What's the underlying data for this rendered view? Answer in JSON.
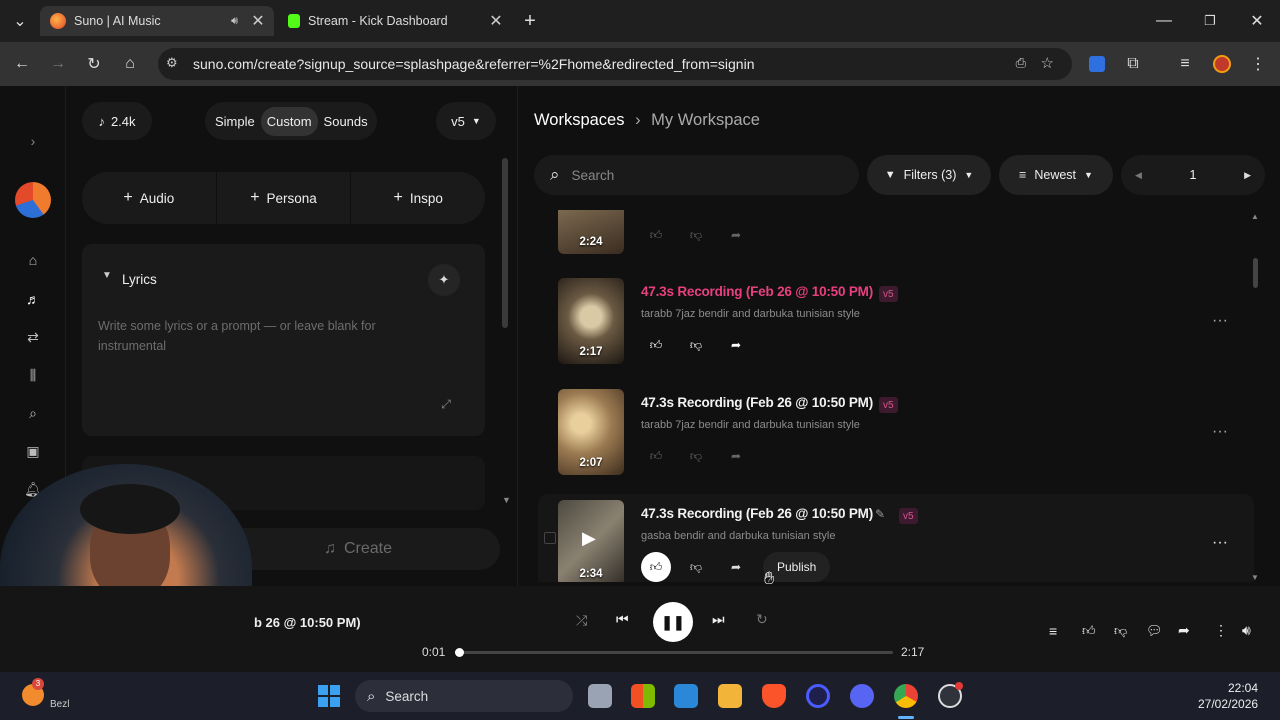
{
  "browser": {
    "tabs": [
      {
        "title": "Suno | AI Music",
        "active": true,
        "audio": true
      },
      {
        "title": "Stream - Kick Dashboard",
        "active": false
      }
    ],
    "url": "suno.com/create?signup_source=splashpage&referrer=%2Fhome&redirected_from=signin"
  },
  "create_panel": {
    "credits": "2.4k",
    "modes": [
      "Simple",
      "Custom",
      "Sounds"
    ],
    "active_mode": "Custom",
    "model": "v5",
    "add_buttons": [
      "Audio",
      "Persona",
      "Inspo"
    ],
    "lyrics_label": "Lyrics",
    "lyrics_placeholder": "Write some lyrics or a prompt — or leave blank for instrumental",
    "create_label": "Create"
  },
  "workspace": {
    "breadcrumb_root": "Workspaces",
    "breadcrumb_current": "My Workspace",
    "search_placeholder": "Search",
    "filters_label": "Filters (3)",
    "sort_label": "Newest",
    "page_number": "1"
  },
  "songs": [
    {
      "duration": "2:24",
      "partial": true
    },
    {
      "title": "47.3s Recording (Feb 26 @ 10:50 PM)",
      "badge": "v5",
      "description": "tarabb 7jaz bendir and darbuka tunisian style",
      "duration": "2:17",
      "playing": true
    },
    {
      "title": "47.3s Recording (Feb 26 @ 10:50 PM)",
      "badge": "v5",
      "description": "tarabb 7jaz bendir and darbuka tunisian style",
      "duration": "2:07"
    },
    {
      "title": "47.3s Recording (Feb 26 @ 10:50 PM)",
      "badge": "v5",
      "description": "gasba bendir and darbuka tunisian style",
      "duration": "2:34",
      "publish_label": "Publish"
    }
  ],
  "player": {
    "now_playing": "b 26 @ 10:50 PM)",
    "elapsed": "0:01",
    "total": "2:17",
    "progress": 0.01
  },
  "taskbar": {
    "search_label": "Search",
    "weather_label": "Bezl",
    "notification_count": "3",
    "time": "22:04",
    "date": "27/02/2026"
  },
  "colors": {
    "accent_pink": "#e8407f",
    "badge_bg": "#3e1a2e",
    "badge_text": "#d3578e"
  }
}
